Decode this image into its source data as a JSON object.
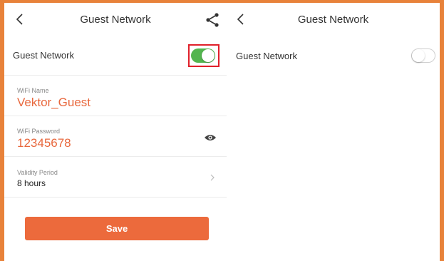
{
  "left_screen": {
    "header": {
      "title": "Guest Network"
    },
    "guest_network": {
      "label": "Guest Network",
      "enabled": true
    },
    "wifi_name": {
      "label": "WiFi Name",
      "value": "Vektor_Guest"
    },
    "wifi_password": {
      "label": "WiFi Password",
      "value": "12345678"
    },
    "validity_period": {
      "label": "Validity Period",
      "value": "8 hours"
    },
    "save_label": "Save"
  },
  "right_screen": {
    "header": {
      "title": "Guest Network"
    },
    "guest_network": {
      "label": "Guest Network",
      "enabled": false
    }
  },
  "colors": {
    "frame": "#e8823a",
    "accent": "#ec6a3c",
    "value_text": "#e8673c",
    "toggle_on": "#53b54f",
    "highlight": "#e0202a"
  },
  "icons": [
    "back-arrow-icon",
    "share-icon",
    "eye-icon",
    "chevron-right-icon"
  ]
}
